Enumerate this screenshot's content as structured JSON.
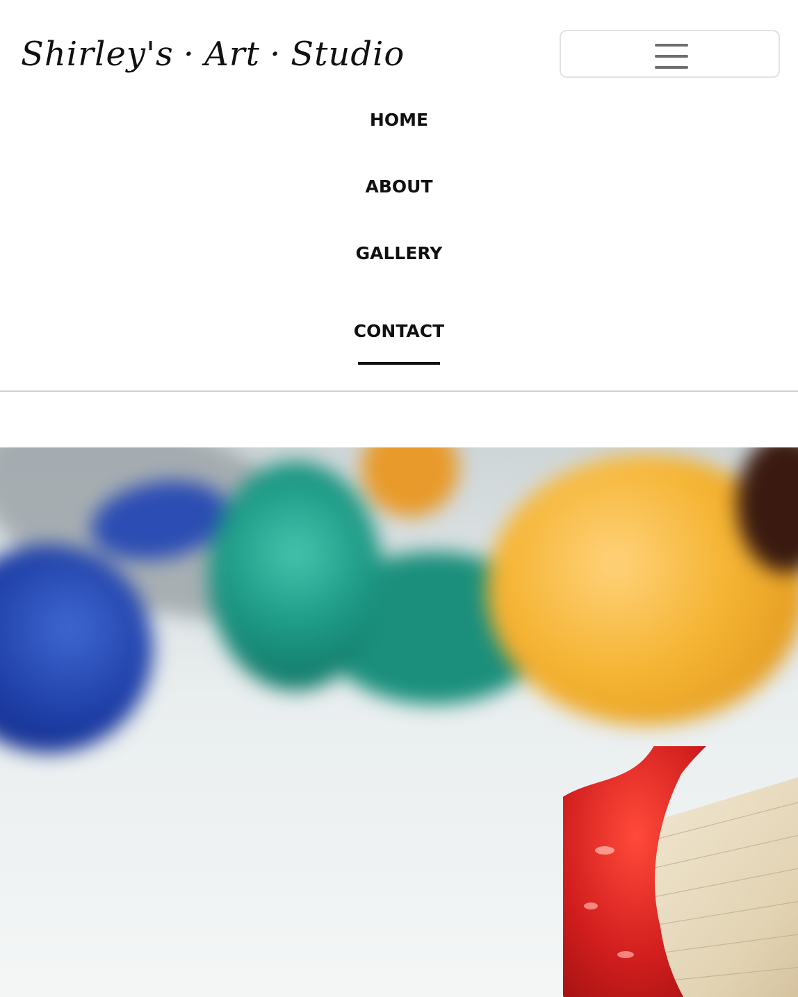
{
  "header": {
    "brand": {
      "word1": "Shirley's",
      "separator": "·",
      "word2": "Art",
      "word3": "Studio"
    },
    "menu_toggle_icon": "hamburger-menu-icon"
  },
  "nav": {
    "items": [
      {
        "label": "HOME",
        "active": false
      },
      {
        "label": "ABOUT",
        "active": false
      },
      {
        "label": "GALLERY",
        "active": false
      },
      {
        "label": "CONTACT",
        "active": true
      }
    ]
  },
  "hero": {
    "image": "paint-tubes-and-brush-photo",
    "colors": {
      "blue": "#1e3fa7",
      "teal": "#1d9a86",
      "yellow": "#f5b433",
      "red": "#d21e1e",
      "bristles": "#e8dcc2"
    }
  }
}
